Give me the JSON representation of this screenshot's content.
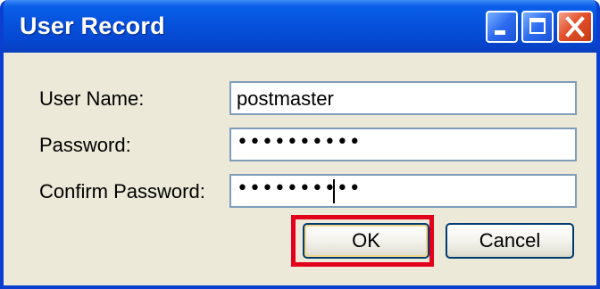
{
  "window": {
    "title": "User Record",
    "controls": {
      "minimize": "minimize-icon",
      "maximize": "maximize-icon",
      "close": "close-icon"
    },
    "title_color": "#0a5fe8",
    "close_color": "#e2512c"
  },
  "form": {
    "fields": [
      {
        "label": "User Name:",
        "value": "postmaster",
        "type": "text"
      },
      {
        "label": "Password:",
        "value": "••••••••••",
        "type": "password"
      },
      {
        "label": "Confirm Password:",
        "value": "••••••••••",
        "type": "password",
        "focused": true
      }
    ]
  },
  "buttons": {
    "ok_label": "OK",
    "cancel_label": "Cancel"
  },
  "annotation": {
    "highlight_color": "#e3001b",
    "highlighted": "ok-button"
  }
}
